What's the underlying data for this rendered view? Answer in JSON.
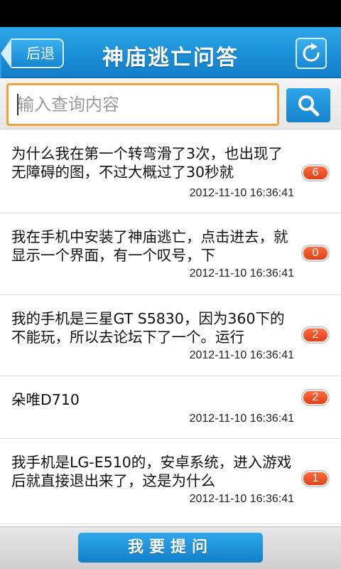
{
  "header": {
    "back_label": "后退",
    "title": "神庙逃亡问答",
    "refresh_icon": "refresh-icon"
  },
  "search": {
    "placeholder": "输入查询内容",
    "value": "",
    "button_icon": "search-icon"
  },
  "questions": [
    {
      "text": "为什么我在第一个转弯滑了3次，也出现了无障碍的图，不过大概过了30秒就",
      "time": "2012-11-10 16:36:41",
      "count": "6"
    },
    {
      "text": "我在手机中安装了神庙逃亡，点击进去，就显示一个界面，有一个叹号，下",
      "time": "2012-11-10 16:36:41",
      "count": "0"
    },
    {
      "text": "我的手机是三星GT S5830，因为360下的不能玩，所以去论坛下了一个。运行",
      "time": "2012-11-10 16:36:41",
      "count": "2"
    },
    {
      "text": "朵唯D710",
      "time": "2012-11-10 16:36:41",
      "count": "2"
    },
    {
      "text": "我手机是LG-E510的，安卓系统，进入游戏后就直接退出来了，这是为什么",
      "time": "2012-11-10 16:36:41",
      "count": "1"
    }
  ],
  "footer": {
    "ask_label": "我要提问"
  },
  "colors": {
    "header_blue": "#1b8fd8",
    "badge_orange": "#e0401a",
    "input_border": "#f0a23c"
  }
}
